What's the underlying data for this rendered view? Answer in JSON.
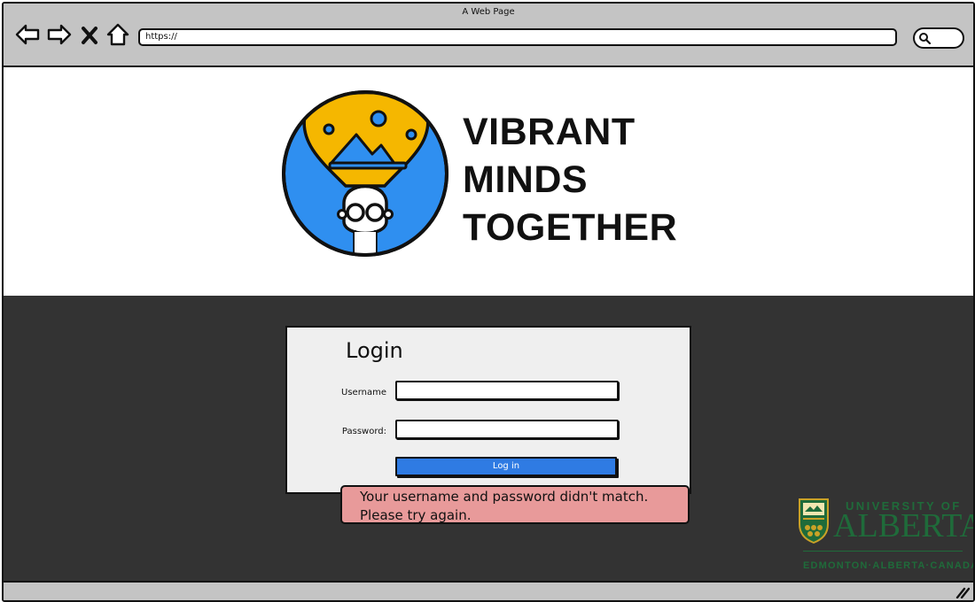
{
  "browser": {
    "window_title": "A Web Page",
    "url": "https://",
    "nav_icons": [
      "back-arrow-icon",
      "forward-arrow-icon",
      "stop-icon",
      "home-icon"
    ],
    "search_icon": "search-icon"
  },
  "header": {
    "brand_lines": [
      "VIBRANT",
      "MINDS",
      "TOGETHER"
    ],
    "logo_icon": "lightbulb-head-icon"
  },
  "login": {
    "title": "Login",
    "username_label": "Username",
    "username_value": "",
    "password_label": "Password:",
    "password_value": "",
    "submit_label": "Log in"
  },
  "error": {
    "line1": "Your username and password didn't match.",
    "line2": "Please try again."
  },
  "university": {
    "line1": "UNIVERSITY OF",
    "line2": "ALBERTA",
    "line3": "EDMONTON·ALBERTA·CANADA"
  },
  "colors": {
    "chrome": "#c4c4c4",
    "dark_band": "#333333",
    "button_blue": "#2f7be3",
    "error_bg": "#e89a9a",
    "logo_blue": "#2f8ff0",
    "logo_gold": "#f5b700",
    "ua_green": "#1f6b3a"
  }
}
